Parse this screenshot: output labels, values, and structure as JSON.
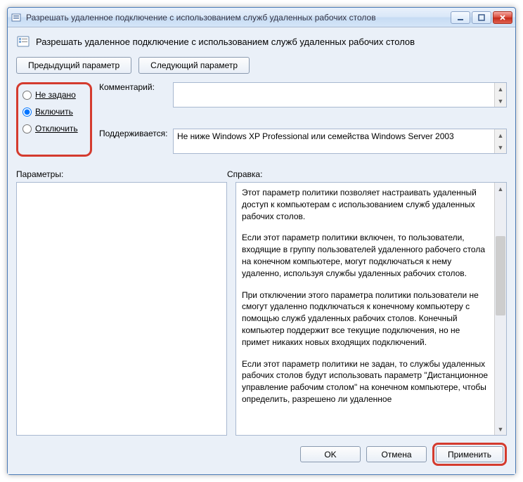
{
  "window": {
    "title": "Разрешать удаленное подключение с использованием служб удаленных рабочих столов"
  },
  "subtitle": "Разрешать удаленное подключение с использованием служб удаленных рабочих столов",
  "nav": {
    "previous": "Предыдущий параметр",
    "next": "Следующий параметр"
  },
  "radios": {
    "not_configured": "Не задано",
    "enabled": "Включить",
    "disabled": "Отключить",
    "selected": "enabled"
  },
  "comment": {
    "label": "Комментарий:",
    "value": ""
  },
  "supported": {
    "label": "Поддерживается:",
    "value": "Не ниже Windows XP Professional или семейства Windows Server 2003"
  },
  "section_labels": {
    "options": "Параметры:",
    "help": "Справка:"
  },
  "help": {
    "p1": "Этот параметр политики позволяет настраивать удаленный доступ к компьютерам с использованием служб удаленных рабочих столов.",
    "p2": "Если этот параметр политики включен, то пользователи, входящие в группу пользователей удаленного рабочего стола на конечном компьютере, могут подключаться к нему удаленно, используя службы удаленных рабочих столов.",
    "p3": "При отключении этого параметра политики пользователи не смогут удаленно подключаться к конечному компьютеру с помощью служб удаленных рабочих столов. Конечный компьютер поддержит все текущие подключения, но не примет никаких новых входящих подключений.",
    "p4": "Если этот параметр политики не задан, то службы удаленных рабочих столов будут использовать параметр \"Дистанционное управление рабочим столом\" на конечном компьютере, чтобы определить, разрешено ли удаленное"
  },
  "footer": {
    "ok": "OK",
    "cancel": "Отмена",
    "apply": "Применить"
  }
}
